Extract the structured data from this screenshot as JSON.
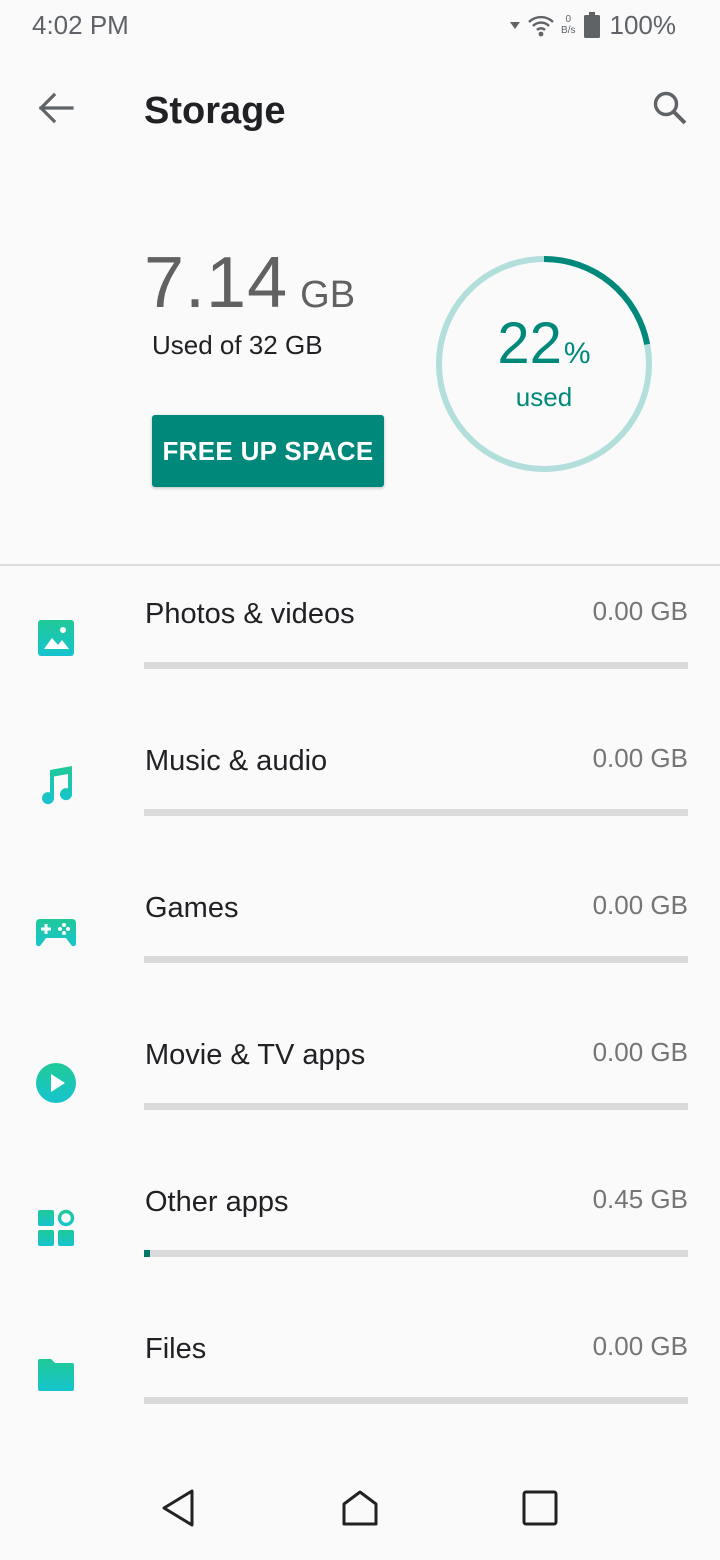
{
  "status_bar": {
    "time": "4:02 PM",
    "net_speed_value": "0",
    "net_speed_unit": "B/s",
    "battery": "100%"
  },
  "app_bar": {
    "title": "Storage",
    "back_icon": "arrow-left-icon",
    "search_icon": "search-icon"
  },
  "summary": {
    "used_value": "7.14",
    "used_unit": "GB",
    "used_of": "Used of 32 GB",
    "free_up_label": "FREE UP SPACE",
    "percent_value": "22",
    "percent_sign": "%",
    "percent_label": "used",
    "used_fraction": 0.22
  },
  "categories": [
    {
      "label": "Photos & videos",
      "size": "0.00 GB",
      "icon": "image-icon",
      "fill_fraction": 0.0
    },
    {
      "label": "Music & audio",
      "size": "0.00 GB",
      "icon": "music-note-icon",
      "fill_fraction": 0.0
    },
    {
      "label": "Games",
      "size": "0.00 GB",
      "icon": "gamepad-icon",
      "fill_fraction": 0.0
    },
    {
      "label": "Movie & TV apps",
      "size": "0.00 GB",
      "icon": "play-circle-icon",
      "fill_fraction": 0.0
    },
    {
      "label": "Other apps",
      "size": "0.45 GB",
      "icon": "apps-icon",
      "fill_fraction": 0.011
    },
    {
      "label": "Files",
      "size": "0.00 GB",
      "icon": "folder-icon",
      "fill_fraction": 0.0
    }
  ],
  "nav_bar": {
    "back_icon": "nav-back-icon",
    "home_icon": "nav-home-icon",
    "recents_icon": "nav-recents-icon"
  },
  "colors": {
    "accent": "#00897b",
    "accent_dark": "#00796b",
    "ring_track": "#b2dfdb",
    "icon_teal": "#1dc9b0",
    "background": "#fafafa"
  }
}
